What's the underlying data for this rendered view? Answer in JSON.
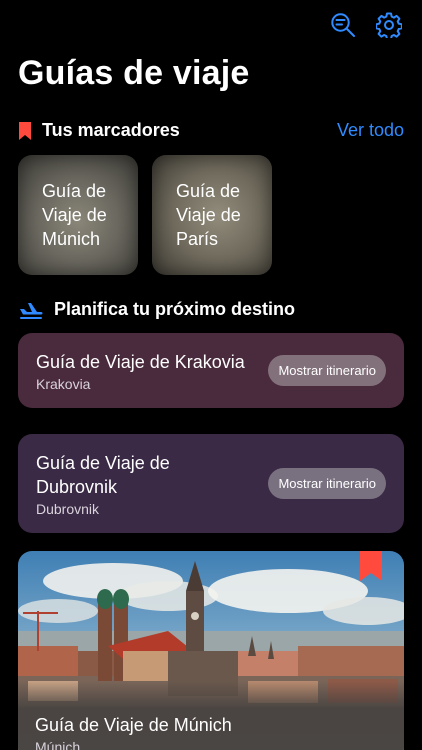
{
  "header": {
    "title": "Guías de viaje"
  },
  "bookmarks_section": {
    "title": "Tus marcadores",
    "see_all": "Ver todo",
    "items": [
      {
        "label": "Guía de Viaje de Múnich"
      },
      {
        "label": "Guía de Viaje de París"
      }
    ]
  },
  "plan_section": {
    "title": "Planifica tu próximo destino",
    "cards": [
      {
        "name": "Guía de Viaje de Krakovia",
        "city": "Krakovia",
        "button": "Mostrar itinerario"
      },
      {
        "name": "Guía de Viaje de Dubrovnik",
        "city": "Dubrovnik",
        "button": "Mostrar itinerario"
      }
    ],
    "image_card": {
      "name": "Guía de Viaje de Múnich",
      "city": "Múnich"
    }
  },
  "icons": {
    "search": "search-filter-icon",
    "settings": "gear-icon",
    "bookmark": "bookmark-icon",
    "plane": "plane-icon"
  },
  "colors": {
    "accent": "#2f8bff",
    "bookmark_red": "#ff4a3d",
    "krakow_card": "#4a2a3d",
    "dubrovnik_card": "#3a2a45"
  }
}
